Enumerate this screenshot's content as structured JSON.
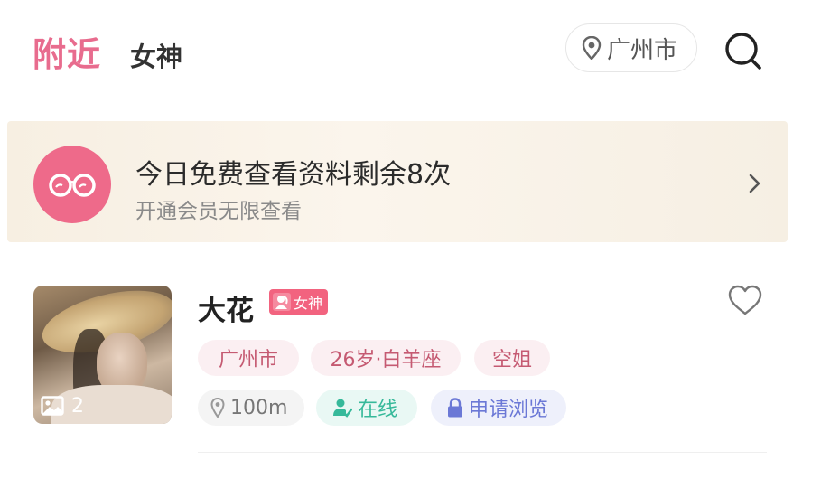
{
  "header": {
    "tab_active": "附近",
    "tab_inactive": "女神",
    "location_icon": "map-pin-icon",
    "location_city": "广州市",
    "search_icon": "search-icon"
  },
  "banner": {
    "icon": "glasses-icon",
    "title": "今日免费查看资料剩余8次",
    "subtitle": "开通会员无限查看",
    "chevron_icon": "chevron-right-icon"
  },
  "profile": {
    "name": "大花",
    "badge_label": "女神",
    "photo_count": "2",
    "tags": [
      "广州市",
      "26岁·白羊座",
      "空姐"
    ],
    "distance": "100m",
    "online_status": "在线",
    "request_label": "申请浏览",
    "favorite_icon": "heart-outline-icon"
  },
  "colors": {
    "accent_pink": "#e86c8e",
    "badge_pink": "#f2637f",
    "online_green": "#36b99a",
    "request_blue": "#6b78d6"
  }
}
